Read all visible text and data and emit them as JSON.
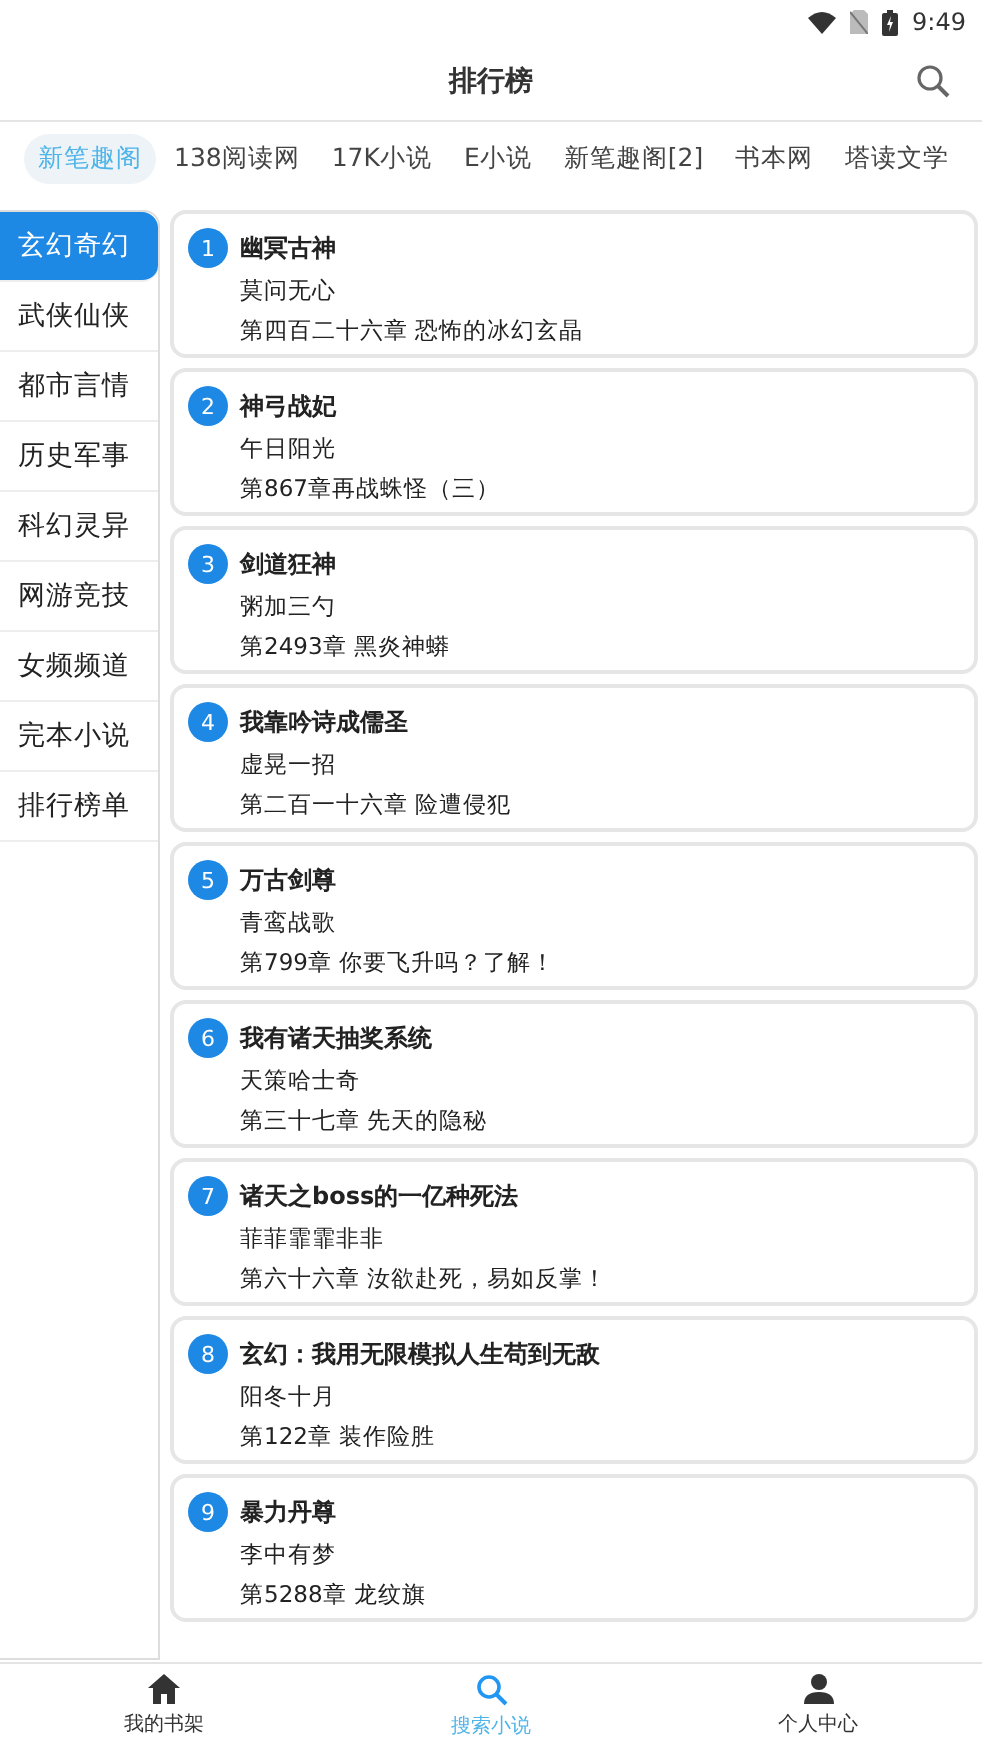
{
  "status_bar": {
    "time": "9:49"
  },
  "header": {
    "title": "排行榜"
  },
  "tabs": [
    {
      "label": "新笔趣阁",
      "selected": true
    },
    {
      "label": "138阅读网",
      "selected": false
    },
    {
      "label": "17K小说",
      "selected": false
    },
    {
      "label": "E小说",
      "selected": false
    },
    {
      "label": "新笔趣阁[2]",
      "selected": false
    },
    {
      "label": "书本网",
      "selected": false
    },
    {
      "label": "塔读文学",
      "selected": false
    }
  ],
  "sidebar": {
    "items": [
      {
        "label": "玄幻奇幻",
        "selected": true
      },
      {
        "label": "武侠仙侠",
        "selected": false
      },
      {
        "label": "都市言情",
        "selected": false
      },
      {
        "label": "历史军事",
        "selected": false
      },
      {
        "label": "科幻灵异",
        "selected": false
      },
      {
        "label": "网游竞技",
        "selected": false
      },
      {
        "label": "女频频道",
        "selected": false
      },
      {
        "label": "完本小说",
        "selected": false
      },
      {
        "label": "排行榜单",
        "selected": false
      }
    ]
  },
  "books": [
    {
      "rank": "1",
      "title": "幽冥古神",
      "author": "莫问无心",
      "chapter": "第四百二十六章 恐怖的冰幻玄晶"
    },
    {
      "rank": "2",
      "title": "神弓战妃",
      "author": "午日阳光",
      "chapter": "第867章再战蛛怪（三）"
    },
    {
      "rank": "3",
      "title": "剑道狂神",
      "author": "粥加三勺",
      "chapter": "第2493章 黑炎神蟒"
    },
    {
      "rank": "4",
      "title": "我靠吟诗成儒圣",
      "author": "虚晃一招",
      "chapter": "第二百一十六章 险遭侵犯"
    },
    {
      "rank": "5",
      "title": "万古剑尊",
      "author": "青鸾战歌",
      "chapter": "第799章 你要飞升吗？了解！"
    },
    {
      "rank": "6",
      "title": "我有诸天抽奖系统",
      "author": "天策哈士奇",
      "chapter": "第三十七章 先天的隐秘"
    },
    {
      "rank": "7",
      "title": "诸天之boss的一亿种死法",
      "author": "菲菲霏霏非非",
      "chapter": "第六十六章 汝欲赴死，易如反掌！"
    },
    {
      "rank": "8",
      "title": "玄幻：我用无限模拟人生苟到无敌",
      "author": "阳冬十月",
      "chapter": "第122章 装作险胜"
    },
    {
      "rank": "9",
      "title": "暴力丹尊",
      "author": "李中有梦",
      "chapter": "第5288章 龙纹旗"
    }
  ],
  "bottom_nav": [
    {
      "label": "我的书架",
      "kind": "home",
      "selected": false
    },
    {
      "label": "搜索小说",
      "kind": "search",
      "selected": true
    },
    {
      "label": "个人中心",
      "kind": "person",
      "selected": false
    }
  ]
}
